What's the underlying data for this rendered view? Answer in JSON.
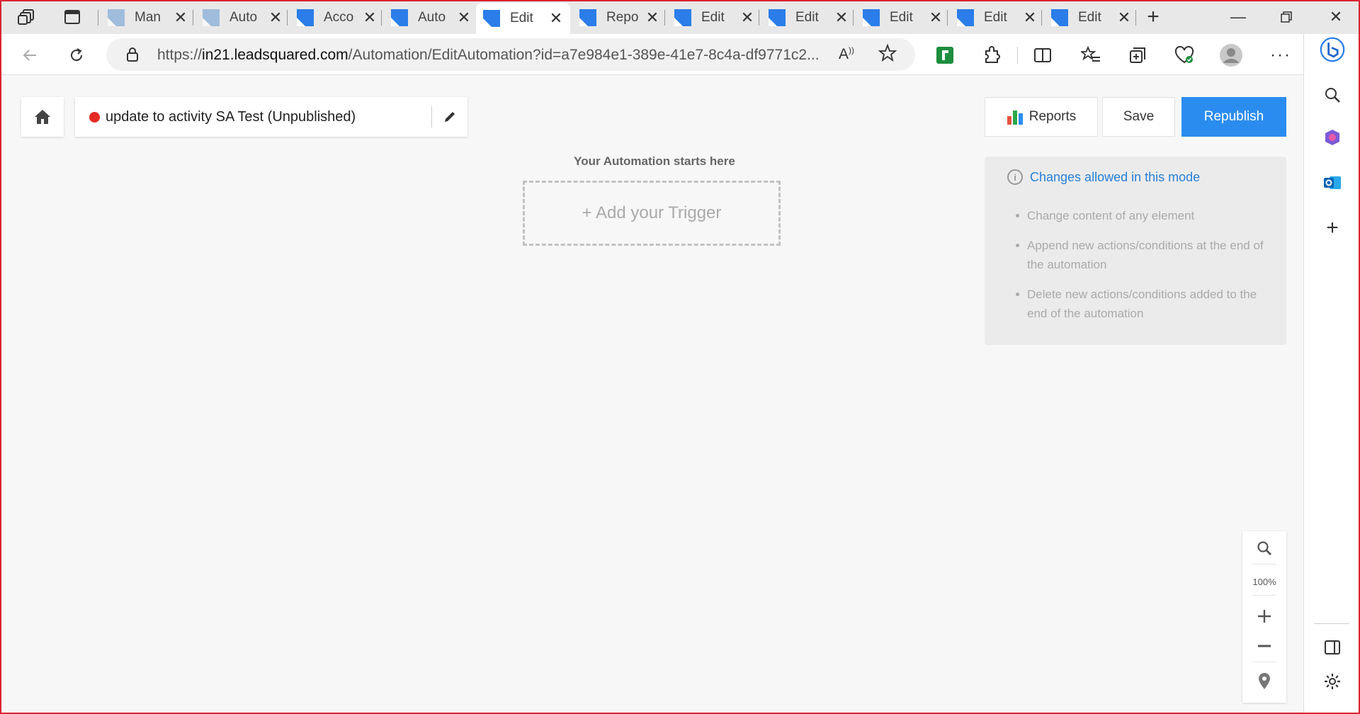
{
  "browser": {
    "tabs": [
      {
        "title": "Man",
        "favicon": "grey"
      },
      {
        "title": "Auto",
        "favicon": "grey"
      },
      {
        "title": "Acco",
        "favicon": "blue"
      },
      {
        "title": "Auto",
        "favicon": "blue"
      },
      {
        "title": "Edit",
        "favicon": "blue",
        "active": true
      },
      {
        "title": "Repo",
        "favicon": "blue"
      },
      {
        "title": "Edit",
        "favicon": "blue"
      },
      {
        "title": "Edit",
        "favicon": "blue"
      },
      {
        "title": "Edit",
        "favicon": "blue"
      },
      {
        "title": "Edit",
        "favicon": "blue"
      },
      {
        "title": "Edit",
        "favicon": "blue"
      }
    ],
    "url_prefix": "https://",
    "url_host": "in21.leadsquared.com",
    "url_path": "/Automation/EditAutomation?id=a7e984e1-389e-41e7-8c4a-df9771c2..."
  },
  "app": {
    "automation_name": "update to activity SA Test (Unpublished)",
    "status_color": "#e52b23",
    "buttons": {
      "reports": "Reports",
      "save": "Save",
      "republish": "Republish"
    },
    "canvas": {
      "starts_here": "Your Automation starts here",
      "add_trigger": "+ Add your Trigger"
    },
    "info_panel": {
      "heading": "Changes allowed in this mode",
      "items": [
        "Change content of any element",
        "Append new actions/conditions at the end of the automation",
        "Delete new actions/conditions added to the end of the automation"
      ]
    },
    "zoom": {
      "level": "100%"
    },
    "colors": {
      "primary": "#2b8cf0",
      "link": "#2680d6"
    }
  }
}
